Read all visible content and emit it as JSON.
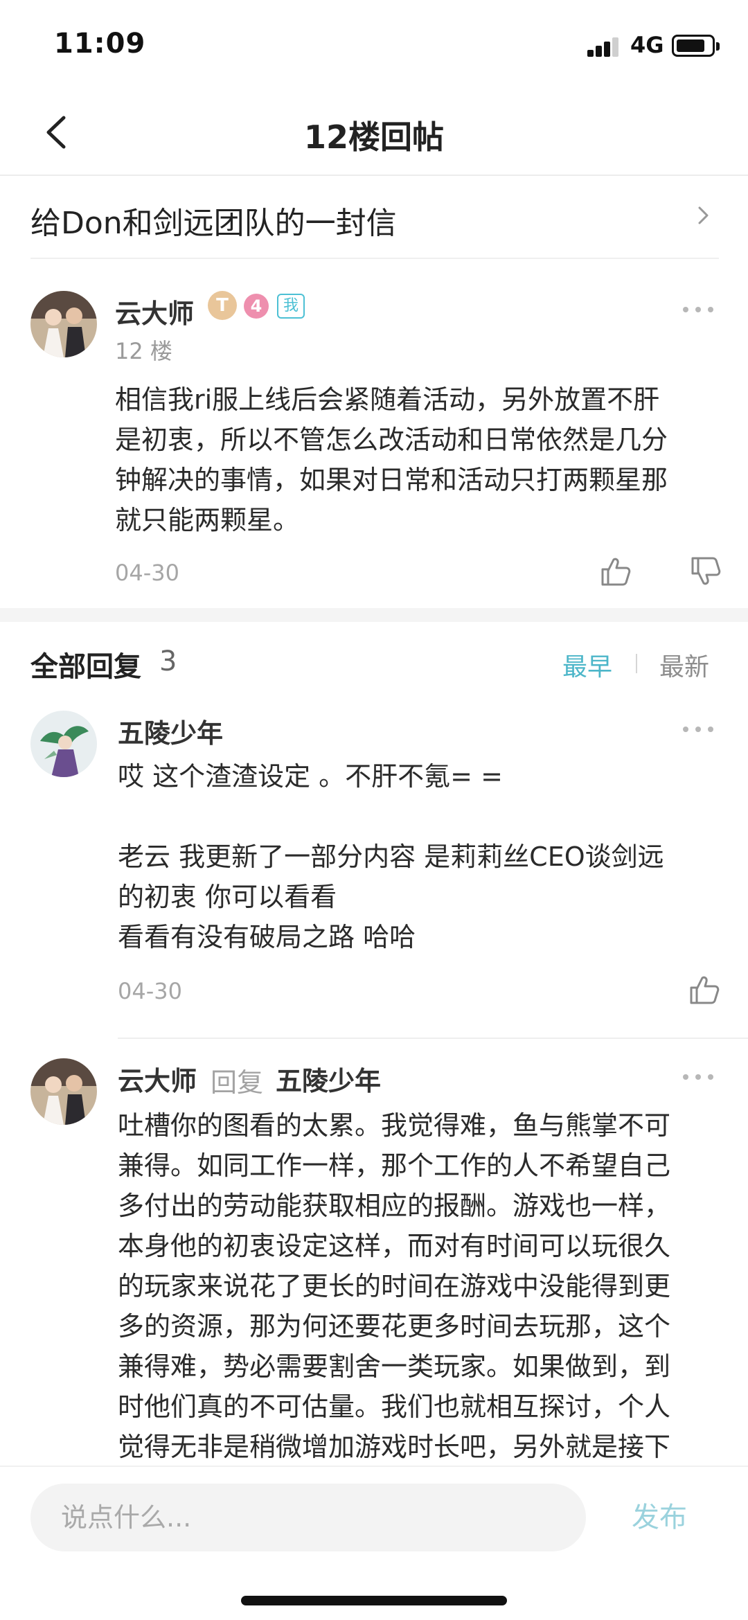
{
  "status": {
    "time": "11:09",
    "network": "4G"
  },
  "nav": {
    "title": "12楼回帖"
  },
  "thread": {
    "title": "给Don和剑远团队的一封信"
  },
  "post": {
    "author": "云大师",
    "badge_t": "T",
    "badge_level": "4",
    "badge_me": "我",
    "floor": "12 楼",
    "content": "相信我ri服上线后会紧随着活动，另外放置不肝\n是初衷，所以不管怎么改活动和日常依然是几分\n钟解决的事情，如果对日常和活动只打两颗星那\n就只能两颗星。",
    "date": "04-30"
  },
  "replies_header": {
    "label": "全部回复",
    "count": "3",
    "sort_earliest": "最早",
    "sort_newest": "最新"
  },
  "replies": [
    {
      "author": "五陵少年",
      "content": "哎 这个渣渣设定 。不肝不氪= =\n\n老云 我更新了一部分内容 是莉莉丝CEO谈剑远\n的初衷 你可以看看\n看看有没有破局之路 哈哈",
      "date": "04-30"
    },
    {
      "author": "云大师",
      "reply_word": "回复",
      "reply_to": "五陵少年",
      "content": "吐槽你的图看的太累。我觉得难，鱼与熊掌不可\n兼得。如同工作一样，那个工作的人不希望自己\n多付出的劳动能获取相应的报酬。游戏也一样，\n本身他的初衷设定这样，而对有时间可以玩很久\n的玩家来说花了更长的时间在游戏中没能得到更\n多的资源，那为何还要花更多时间去玩那，这个\n兼得难，势必需要割舍一类玩家。如果做到，到\n时他们真的不可估量。我们也就相互探讨，个人\n觉得无非是稍微增加游戏时长吧，另外就是接下"
    }
  ],
  "composer": {
    "placeholder": "说点什么...",
    "publish": "发布"
  }
}
